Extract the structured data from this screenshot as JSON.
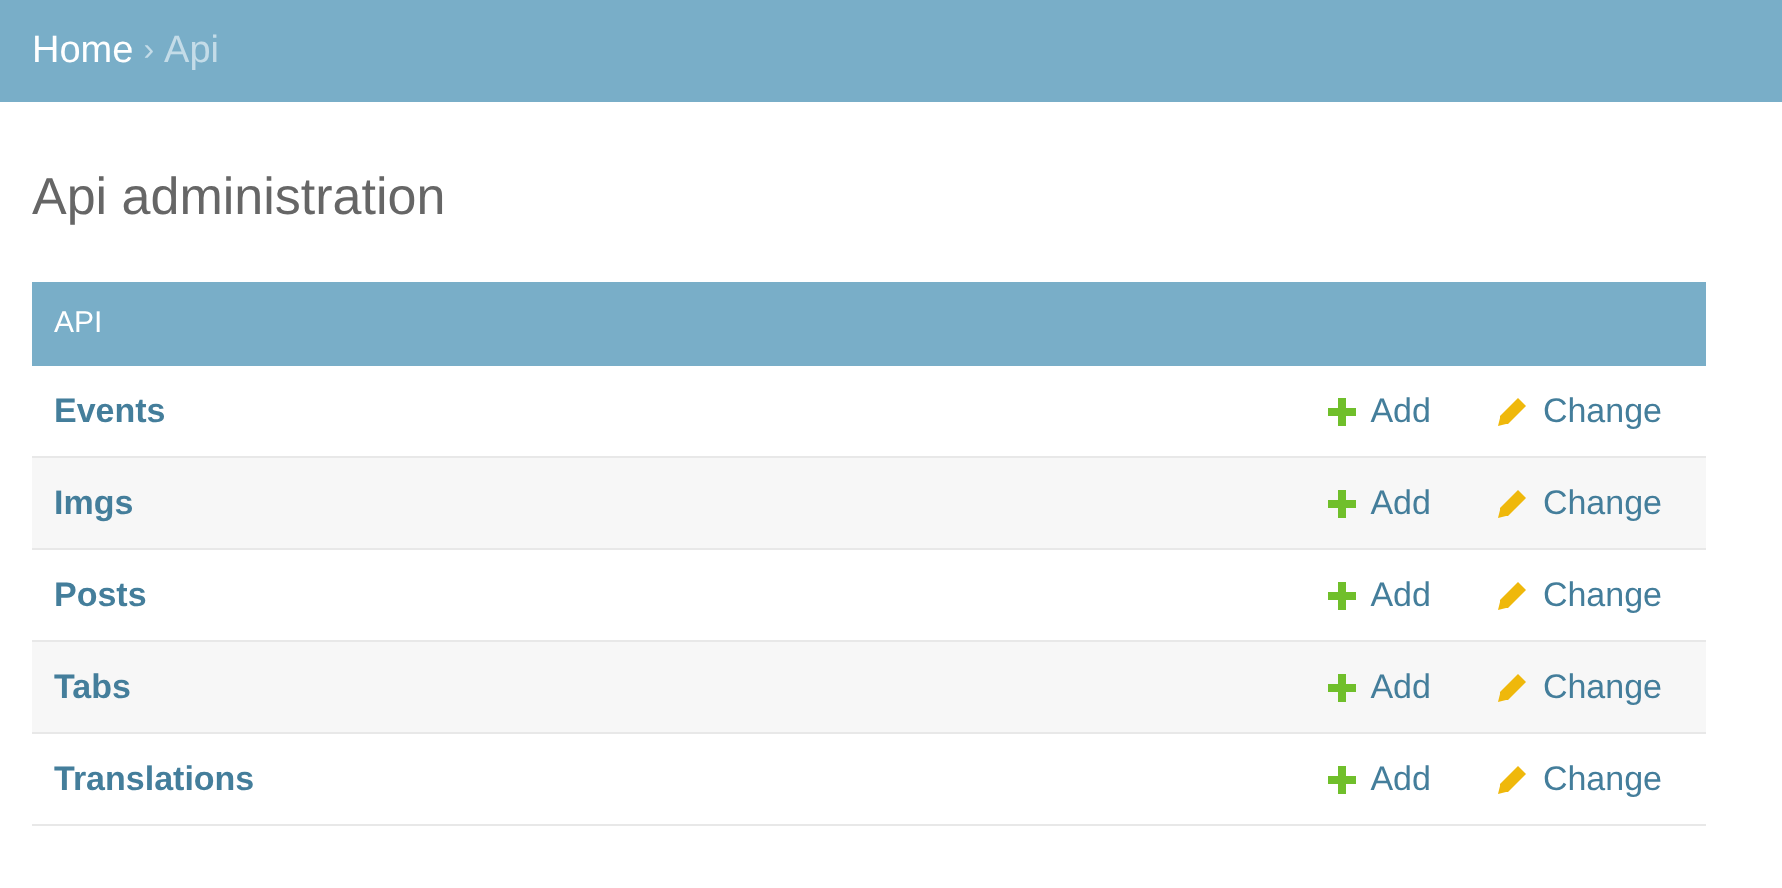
{
  "breadcrumbs": {
    "home": "Home",
    "separator": "›",
    "current": "Api"
  },
  "title": "Api administration",
  "module": {
    "caption": "API",
    "rows": [
      {
        "name": "Events",
        "add": "Add",
        "change": "Change"
      },
      {
        "name": "Imgs",
        "add": "Add",
        "change": "Change"
      },
      {
        "name": "Posts",
        "add": "Add",
        "change": "Change"
      },
      {
        "name": "Tabs",
        "add": "Add",
        "change": "Change"
      },
      {
        "name": "Translations",
        "add": "Add",
        "change": "Change"
      }
    ]
  }
}
